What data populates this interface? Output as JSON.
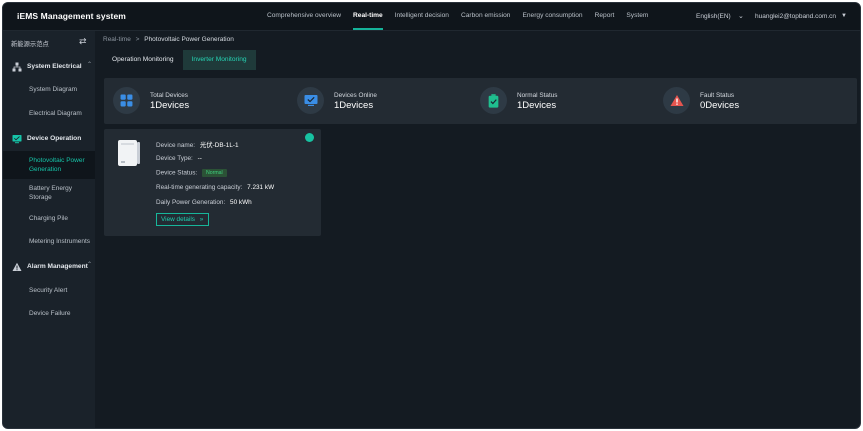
{
  "app": {
    "title": "iEMS Management system"
  },
  "nav": {
    "items": [
      {
        "label": "Comprehensive overview"
      },
      {
        "label": "Real-time"
      },
      {
        "label": "Intelligent decision"
      },
      {
        "label": "Carbon emission"
      },
      {
        "label": "Energy consumption"
      },
      {
        "label": "Report"
      },
      {
        "label": "System"
      }
    ],
    "active_index": 1,
    "language": "English(EN)",
    "user": "huanglei2@topband.com.cn"
  },
  "sidebar": {
    "header": "新能源示范点",
    "groups": [
      {
        "label": "System Electrical",
        "icon": "network-icon",
        "items": [
          "System Diagram",
          "Electrical Diagram"
        ]
      },
      {
        "label": "Device Operation",
        "icon": "monitor-icon",
        "items": [
          "Photovoltaic Power Generation",
          "Battery Energy Storage",
          "Charging Pile",
          "Metering Instruments"
        ],
        "active_item": 0
      },
      {
        "label": "Alarm Management",
        "icon": "warning-icon",
        "items": [
          "Security Alert",
          "Device Failure"
        ]
      }
    ]
  },
  "breadcrumb": {
    "root": "Real-time",
    "separator": ">",
    "current": "Photovoltaic Power Generation"
  },
  "tabs": [
    {
      "label": "Operation Monitoring"
    },
    {
      "label": "Inverter Monitoring"
    }
  ],
  "stats": [
    {
      "label": "Total Devices",
      "value": "1Devices",
      "icon": "grid-icon",
      "color": "#3a8ee6"
    },
    {
      "label": "Devices Online",
      "value": "1Devices",
      "icon": "screen-check-icon",
      "color": "#3a8ee6"
    },
    {
      "label": "Normal Status",
      "value": "1Devices",
      "icon": "battery-check-icon",
      "color": "#1fbf8f"
    },
    {
      "label": "Fault Status",
      "value": "0Devices",
      "icon": "alert-triangle-icon",
      "color": "#e5554f"
    }
  ],
  "device": {
    "name_label": "Device name:",
    "name_value": "光伏-DB-1L-1",
    "type_label": "Device Type:",
    "type_value": "--",
    "status_label": "Device Status:",
    "status_value": "Normal",
    "capacity_label": "Real-time generating capacity:",
    "capacity_value": "7.231 kW",
    "daily_label": "Daily Power Generation:",
    "daily_value": "50 kWh",
    "details_button": "View details",
    "online_color": "#17c2a1"
  }
}
